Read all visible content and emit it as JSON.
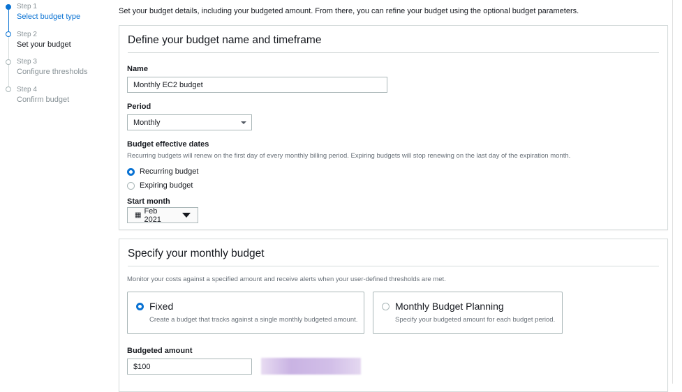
{
  "steps": [
    {
      "num": "Step 1",
      "title": "Select budget type",
      "state": "done"
    },
    {
      "num": "Step 2",
      "title": "Set your budget",
      "state": "current"
    },
    {
      "num": "Step 3",
      "title": "Configure thresholds",
      "state": "pending"
    },
    {
      "num": "Step 4",
      "title": "Confirm budget",
      "state": "pending"
    }
  ],
  "intro": "Set your budget details, including your budgeted amount. From there, you can refine your budget using the optional budget parameters.",
  "panel1": {
    "title": "Define your budget name and timeframe",
    "name_label": "Name",
    "name_value": "Monthly EC2 budget",
    "period_label": "Period",
    "period_value": "Monthly",
    "dates_label": "Budget effective dates",
    "dates_desc": "Recurring budgets will renew on the first day of every monthly billing period. Expiring budgets will stop renewing on the last day of the expiration month.",
    "recurring": "Recurring budget",
    "expiring": "Expiring budget",
    "start_label": "Start month",
    "start_value": "Feb 2021"
  },
  "panel2": {
    "title": "Specify your monthly budget",
    "desc": "Monitor your costs against a specified amount and receive alerts when your user-defined thresholds are met.",
    "fixed_title": "Fixed",
    "fixed_desc": "Create a budget that tracks against a single monthly budgeted amount.",
    "planning_title": "Monthly Budget Planning",
    "planning_desc": "Specify your budgeted amount for each budget period.",
    "amount_label": "Budgeted amount",
    "amount_value": "$100"
  },
  "colors": {
    "accent": "#0972d3"
  }
}
